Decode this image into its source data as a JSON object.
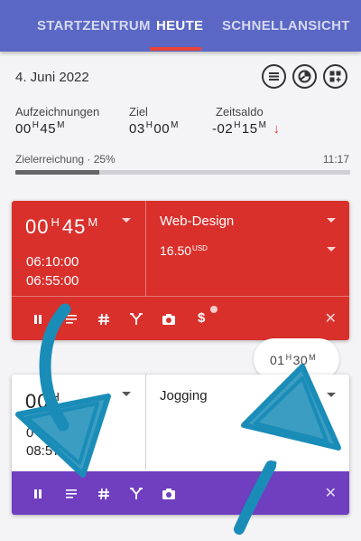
{
  "tabs": [
    {
      "label": "STARTZENTRUM",
      "active": false
    },
    {
      "label": "HEUTE",
      "active": true
    },
    {
      "label": "SCHNELLANSICHT",
      "active": false
    }
  ],
  "header": {
    "date": "4. Juni 2022",
    "icons": [
      "list-icon",
      "pie-chart-icon",
      "add-grid-icon"
    ]
  },
  "stats": {
    "records": {
      "label": "Aufzeichnungen",
      "hours": "00",
      "h_unit": "H",
      "minutes": "45",
      "m_unit": "M"
    },
    "goal": {
      "label": "Ziel",
      "hours": "03",
      "h_unit": "H",
      "minutes": "00",
      "m_unit": "M"
    },
    "balance": {
      "label": "Zeitsaldo",
      "hours": "-02",
      "h_unit": "H",
      "minutes": "15",
      "m_unit": "M",
      "trend_icon": "arrow-down-icon"
    }
  },
  "progress": {
    "label": "Zielerreichung · 25%",
    "value": 0.25,
    "time": "11:17"
  },
  "card1": {
    "hours": "00",
    "h_unit": "H",
    "minutes": "45",
    "m_unit": "M",
    "start": "06:10:00",
    "end": "06:55:00",
    "project": "Web-Design",
    "rate": "16.50",
    "currency": "USD",
    "color": "#d9302c",
    "dollar_label": "$"
  },
  "badge": {
    "hours": "01",
    "h_unit": "H",
    "minutes": "30",
    "m_unit": "M"
  },
  "card2": {
    "hours": "00",
    "h_unit": "H",
    "start": "0",
    "end": "08:57",
    "project": "Jogging",
    "color": "#6f3fc0"
  },
  "actions": [
    "pause-icon",
    "notes-icon",
    "hashtag-icon",
    "merge-icon",
    "camera-icon",
    "dollar-icon",
    "close-icon"
  ],
  "colors": {
    "tabbar": "#5a67c4",
    "tab_indicator": "#e8433a",
    "scribble": "#1a8cb8"
  }
}
